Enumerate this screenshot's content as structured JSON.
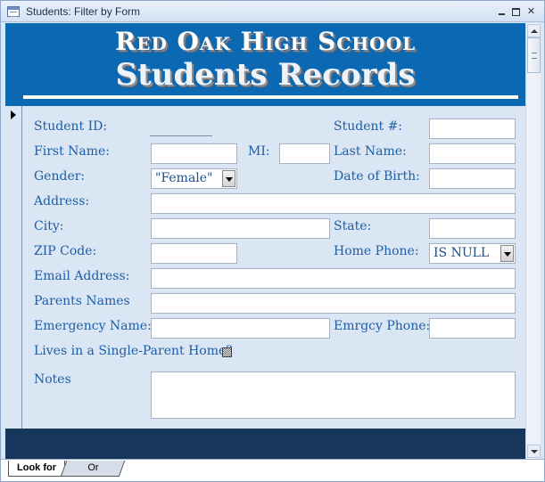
{
  "window": {
    "title": "Students: Filter by Form"
  },
  "header": {
    "school": "Red Oak High School",
    "title": "Students Records"
  },
  "form": {
    "student_id_label": "Student ID:",
    "student_num_label": "Student #:",
    "first_name_label": "First Name:",
    "mi_label": "MI:",
    "last_name_label": "Last Name:",
    "gender_label": "Gender:",
    "gender_value": "\"Female\"",
    "dob_label": "Date of Birth:",
    "address_label": "Address:",
    "city_label": "City:",
    "state_label": "State:",
    "zip_label": "ZIP Code:",
    "home_phone_label": "Home Phone:",
    "home_phone_value": "IS NULL",
    "email_label": "Email Address:",
    "parents_label": "Parents Names",
    "emergency_name_label": "Emergency Name:",
    "emergency_phone_label": "Emrgcy Phone:",
    "single_parent_label": "Lives in a Single-Parent Home?",
    "notes_label": "Notes"
  },
  "tabs": {
    "look_for": "Look for",
    "or": "Or"
  }
}
